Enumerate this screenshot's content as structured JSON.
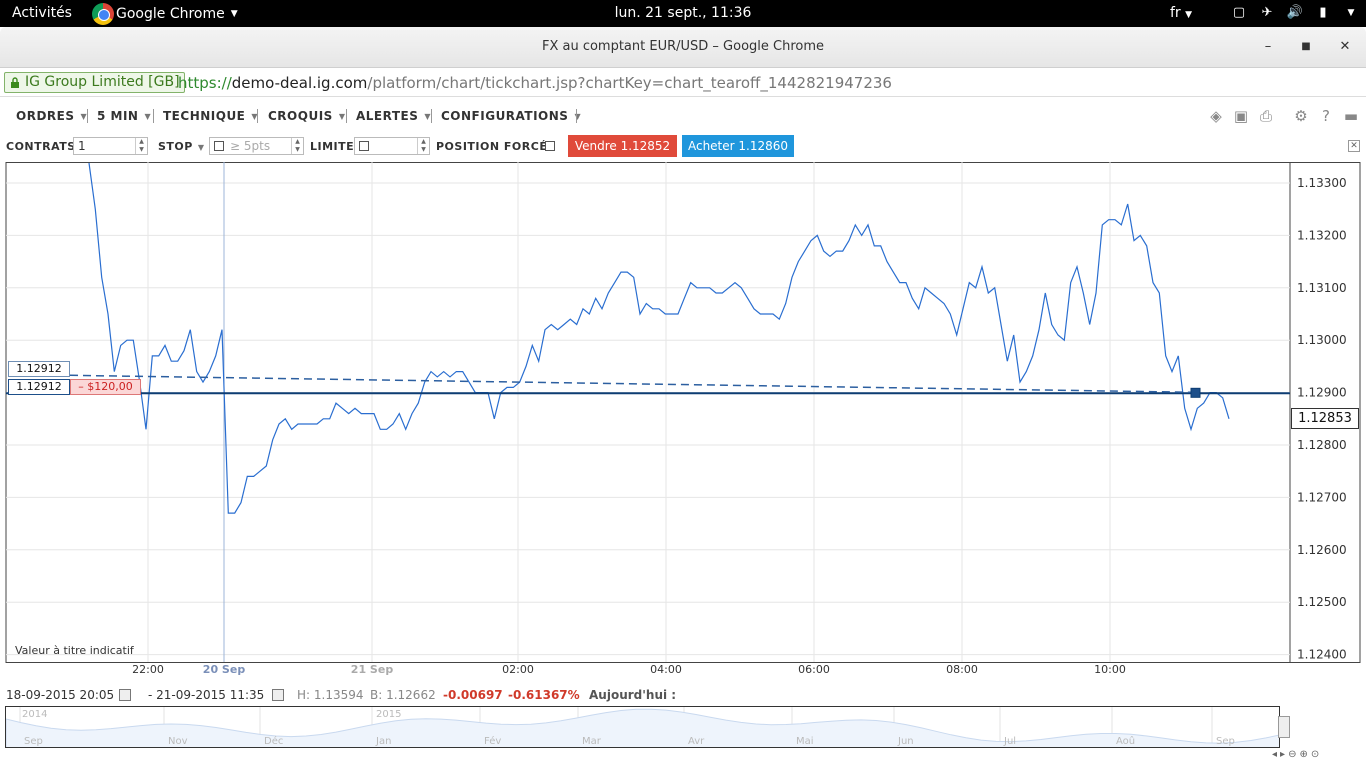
{
  "topbar": {
    "activities": "Activités",
    "app_name": "Google Chrome",
    "clock": "lun. 21 sept., 11:36",
    "lang": "fr"
  },
  "window": {
    "title": "FX au comptant EUR/USD – Google Chrome"
  },
  "address": {
    "secure_label": "IG Group Limited [GB]",
    "scheme": "https://",
    "host": "demo-deal.ig.com",
    "path": "/platform/chart/tickchart.jsp?chartKey=chart_tearoff_1442821947236"
  },
  "menu": {
    "orders": "ORDRES",
    "interval": "5 MIN",
    "technical": "TECHNIQUE",
    "sketch": "CROQUIS",
    "alerts": "ALERTES",
    "configs": "CONFIGURATIONS"
  },
  "order": {
    "contracts_label": "CONTRATS",
    "contracts_value": "1",
    "stop_label": "STOP",
    "stop_placeholder": "≥ 5pts",
    "limit_label": "LIMITE",
    "forced_label": "POSITION FORCÉE",
    "sell_label": "Vendre 1.12852",
    "buy_label": "Acheter 1.12860"
  },
  "chart_labels": {
    "current_price": "1.12853",
    "tag_upper": "1.12912",
    "tag_lower": "1.12912",
    "pl": "– $120,00",
    "indicative": "Valeur à titre indicatif"
  },
  "range": {
    "from": "18-09-2015 20:05",
    "to": "- 21-09-2015 11:35",
    "high": "H: 1.13594",
    "low": "B: 1.12662",
    "change": "-0.00697",
    "change_pct": "-0.61367%",
    "today": "Aujourd'hui :"
  },
  "navigator": {
    "years": [
      "2014",
      "2015"
    ],
    "months": [
      "Sep",
      "Nov",
      "Déc",
      "Jan",
      "Fév",
      "Mar",
      "Avr",
      "Mai",
      "Jun",
      "Jul",
      "Aoû",
      "Sep"
    ]
  },
  "chart_data": {
    "type": "line",
    "ylim": [
      1.124,
      1.1335
    ],
    "y_ticks": [
      "1.13300",
      "1.13200",
      "1.13100",
      "1.13000",
      "1.12900",
      "1.12800",
      "1.12700",
      "1.12600",
      "1.12500",
      "1.12400"
    ],
    "x_ticks": [
      {
        "label": "22:00",
        "kind": "time"
      },
      {
        "label": "20 Sep",
        "kind": "date"
      },
      {
        "label": "21 Sep",
        "kind": "date-dim"
      },
      {
        "label": "02:00",
        "kind": "time"
      },
      {
        "label": "04:00",
        "kind": "time"
      },
      {
        "label": "06:00",
        "kind": "time"
      },
      {
        "label": "08:00",
        "kind": "time"
      },
      {
        "label": "10:00",
        "kind": "time"
      }
    ],
    "open_position_level": 1.12912,
    "series": [
      {
        "values": [
          1.1334,
          1.1325,
          1.1312,
          1.1305,
          1.1294,
          1.1299,
          1.13,
          1.13,
          1.1292,
          1.1283,
          1.1297,
          1.1297,
          1.1299,
          1.1296,
          1.1296,
          1.1298,
          1.1302,
          1.1294,
          1.1292,
          1.1294,
          1.1297,
          1.1302,
          1.1267,
          1.1267,
          1.1269,
          1.1274,
          1.1274,
          1.1275,
          1.1276,
          1.1281,
          1.1284,
          1.1285,
          1.1283,
          1.1284,
          1.1284,
          1.1284,
          1.1284,
          1.1285,
          1.1285,
          1.1288,
          1.1287,
          1.1286,
          1.1287,
          1.1286,
          1.1286,
          1.1286,
          1.1283,
          1.1283,
          1.1284,
          1.1286,
          1.1283,
          1.1286,
          1.1288,
          1.1292,
          1.1294,
          1.1293,
          1.1294,
          1.1293,
          1.1294,
          1.1294,
          1.1292,
          1.129,
          1.129,
          1.129,
          1.1285,
          1.129,
          1.1291,
          1.1291,
          1.1292,
          1.1295,
          1.1299,
          1.1296,
          1.1302,
          1.1303,
          1.1302,
          1.1303,
          1.1304,
          1.1303,
          1.1306,
          1.1305,
          1.1308,
          1.1306,
          1.1309,
          1.1311,
          1.1313,
          1.1313,
          1.1312,
          1.1305,
          1.1307,
          1.1306,
          1.1306,
          1.1305,
          1.1305,
          1.1305,
          1.1308,
          1.1311,
          1.131,
          1.131,
          1.131,
          1.1309,
          1.1309,
          1.131,
          1.1311,
          1.131,
          1.1308,
          1.1306,
          1.1305,
          1.1305,
          1.1305,
          1.1304,
          1.1307,
          1.1312,
          1.1315,
          1.1317,
          1.1319,
          1.132,
          1.1317,
          1.1316,
          1.1317,
          1.1317,
          1.1319,
          1.1322,
          1.132,
          1.1322,
          1.1318,
          1.1318,
          1.1315,
          1.1313,
          1.1311,
          1.1311,
          1.1308,
          1.1306,
          1.131,
          1.1309,
          1.1308,
          1.1307,
          1.1305,
          1.1301,
          1.1306,
          1.1311,
          1.131,
          1.1314,
          1.1309,
          1.131,
          1.1303,
          1.1296,
          1.1301,
          1.1292,
          1.1294,
          1.1297,
          1.1302,
          1.1309,
          1.1303,
          1.1301,
          1.13,
          1.1311,
          1.1314,
          1.1309,
          1.1303,
          1.1309,
          1.1322,
          1.1323,
          1.1323,
          1.1322,
          1.1326,
          1.1319,
          1.132,
          1.1318,
          1.1311,
          1.1309,
          1.1297,
          1.1294,
          1.1297,
          1.1287,
          1.1283,
          1.1287,
          1.1288,
          1.129,
          1.129,
          1.1289,
          1.1285
        ]
      }
    ]
  }
}
